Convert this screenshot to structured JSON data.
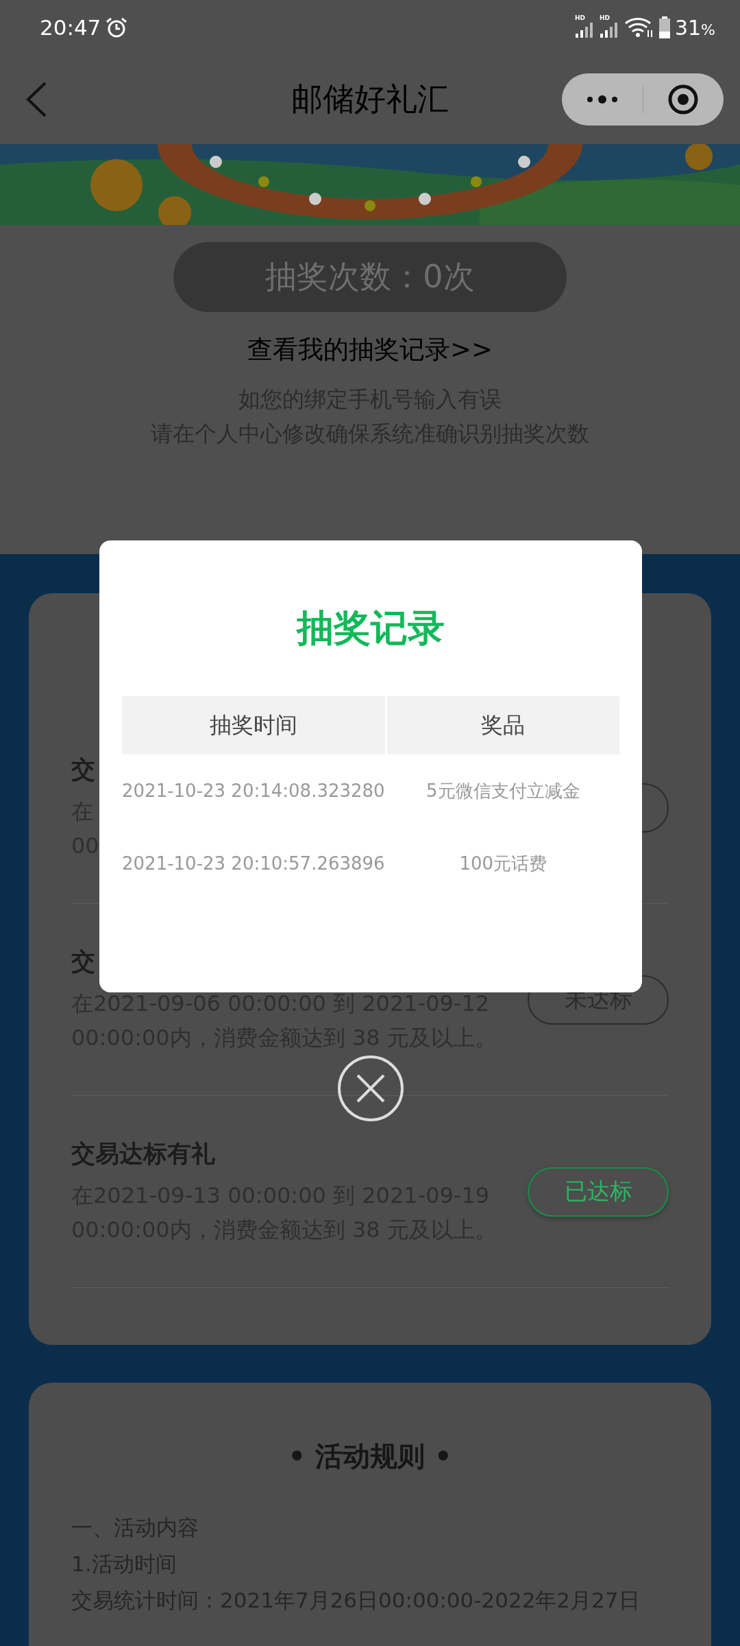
{
  "status_bar": {
    "time": "20:47",
    "signals": [
      "HD",
      "HD"
    ],
    "battery": "31",
    "battery_unit": "%"
  },
  "nav": {
    "title": "邮储好礼汇"
  },
  "banner": {
    "kind": "picture"
  },
  "draw_count": {
    "label": "抽奖次数：0次",
    "disabled": true
  },
  "record_link": "查看我的抽奖记录>>",
  "notice": [
    "如您的绑定手机号输入有误",
    "请在个人中心修改确保系统准确识别抽奖次数"
  ],
  "tasks": [
    {
      "title": "交",
      "desc": [
        "在",
        "00"
      ],
      "achieved": false
    },
    {
      "title": "交",
      "desc": [
        "在2021-09-06 00:00:00 到 2021-09-12",
        "00:00:00内，消费金额达到 38 元及以上。"
      ],
      "status": "未达标",
      "achieved": false
    },
    {
      "title": "交易达标有礼",
      "desc": [
        "在2021-09-13 00:00:00 到 2021-09-19",
        "00:00:00内，消费金额达到 38 元及以上。"
      ],
      "status": "已达标",
      "achieved": true
    }
  ],
  "rules": {
    "title": "• 活动规则 •",
    "lines": [
      "一、活动内容",
      "1.活动时间",
      "交易统计时间：2021年7月26日00:00:00-2022年2月27日"
    ]
  },
  "modal": {
    "title": "抽奖记录",
    "columns": [
      "抽奖时间",
      "奖品"
    ],
    "rows": [
      [
        "2021-10-23 20:14:08.323280",
        "5元微信支付立减金"
      ],
      [
        "2021-10-23 20:10:57.263896",
        "100元话费"
      ]
    ]
  }
}
